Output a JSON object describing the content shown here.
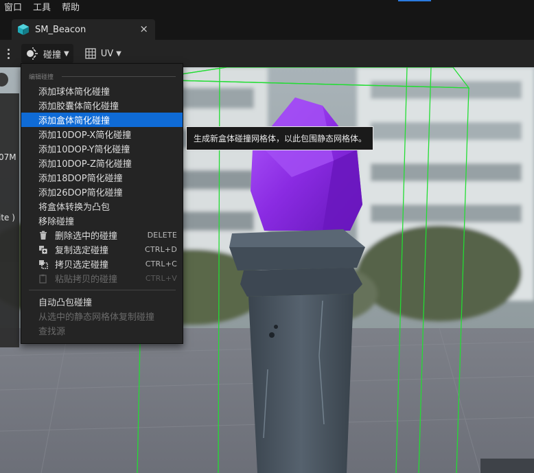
{
  "menubar": {
    "items": [
      "窗口",
      "工具",
      "帮助"
    ]
  },
  "tab": {
    "title": "SM_Beacon",
    "close_glyph": "×",
    "icon": "static-mesh-icon"
  },
  "toolbar": {
    "collision_label": "碰撞",
    "uv_label": "UV",
    "chevron": "⌄"
  },
  "sidepanel": {
    "fragments": [
      "07M",
      "ite )"
    ]
  },
  "menu": {
    "section_title": "编辑碰撞",
    "items": [
      {
        "label": "添加球体简化碰撞"
      },
      {
        "label": "添加胶囊体简化碰撞"
      },
      {
        "label": "添加盒体简化碰撞"
      },
      {
        "label": "添加10DOP-X简化碰撞"
      },
      {
        "label": "添加10DOP-Y简化碰撞"
      },
      {
        "label": "添加10DOP-Z简化碰撞"
      },
      {
        "label": "添加18DOP简化碰撞"
      },
      {
        "label": "添加26DOP简化碰撞"
      },
      {
        "label": "将盒体转换为凸包"
      },
      {
        "label": "移除碰撞"
      },
      {
        "label": "删除选中的碰撞",
        "shortcut": "DELETE"
      },
      {
        "label": "复制选定碰撞",
        "shortcut": "CTRL+D"
      },
      {
        "label": "拷贝选定碰撞",
        "shortcut": "CTRL+C"
      },
      {
        "label": "粘贴拷贝的碰撞",
        "shortcut": "CTRL+V"
      },
      {
        "label": "自动凸包碰撞"
      },
      {
        "label": "从选中的静态网格体复制碰撞"
      },
      {
        "label": "查找源"
      }
    ],
    "selected_index": 2
  },
  "tooltip": {
    "text": "生成新盒体碰撞网格体，以此包围静态网格体。"
  },
  "colors": {
    "accent_blue": "#0f6bd6",
    "collision_green": "#22dd33",
    "crystal_purple": "#8a2be2"
  }
}
